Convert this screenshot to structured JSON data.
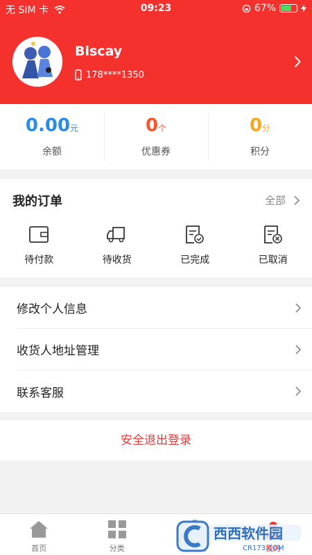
{
  "status_bar": {
    "carrier": "无 SIM 卡",
    "time": "09:23",
    "battery": "67%",
    "battery_level": 0.67
  },
  "profile": {
    "name": "Biscay",
    "phone": "178****1350"
  },
  "stats": [
    {
      "value": "0.00",
      "unit": "元",
      "label": "余额",
      "color": "#2b8ce8"
    },
    {
      "value": "0",
      "unit": "个",
      "label": "优惠券",
      "color": "#f5572e"
    },
    {
      "value": "0",
      "unit": "分",
      "label": "积分",
      "color": "#f5a623"
    }
  ],
  "orders": {
    "title": "我的订单",
    "all_label": "全部",
    "items": [
      {
        "label": "待付款",
        "icon": "wallet-icon"
      },
      {
        "label": "待收货",
        "icon": "truck-icon"
      },
      {
        "label": "已完成",
        "icon": "doc-check-icon"
      },
      {
        "label": "已取消",
        "icon": "doc-cancel-icon"
      }
    ]
  },
  "menu": [
    {
      "label": "修改个人信息"
    },
    {
      "label": "收货人地址管理"
    },
    {
      "label": "联系客服"
    }
  ],
  "logout_label": "安全退出登录",
  "tabs": [
    {
      "label": "首页",
      "icon": "home-icon"
    },
    {
      "label": "分类",
      "icon": "category-icon"
    },
    {
      "label": "购物袋",
      "icon": "bag-icon"
    },
    {
      "label": "我的",
      "icon": "user-icon",
      "active": true
    }
  ],
  "watermark": {
    "brand": "西西软件园",
    "url": "CR173.COM"
  }
}
